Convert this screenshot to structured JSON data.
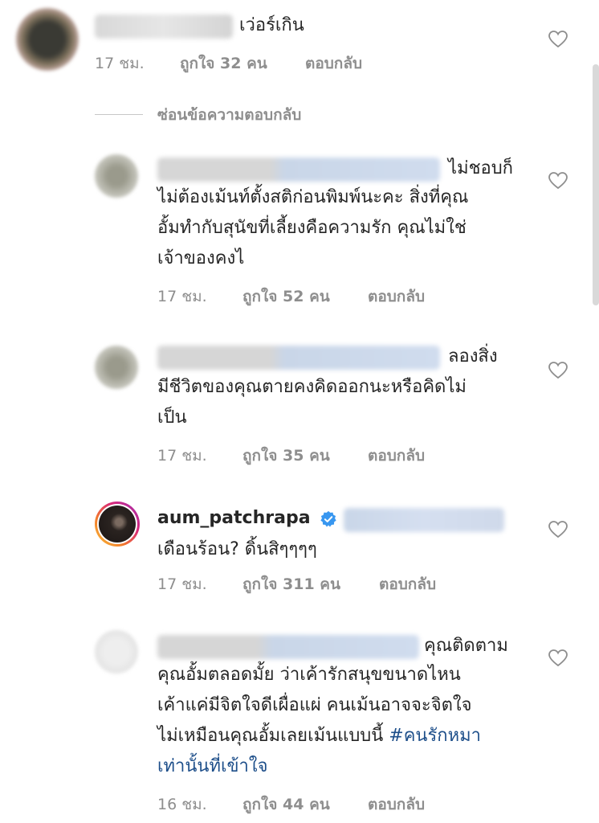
{
  "comments": [
    {
      "text": "เว่อร์เกิน",
      "time": "17 ชม.",
      "likes": "ถูกใจ 32 คน",
      "reply": "ตอบกลับ"
    },
    {
      "text_lines": [
        "ไม่ชอบก็",
        "ไม่ต้องเม้นท์ตั้งสติก่อนพิมพ์นะคะ สิ่งที่คุณ",
        "อั้มทำกับสุนัขที่เลี้ยงคือความรัก คุณไม่ใช่",
        "เจ้าของคงไ"
      ],
      "time": "17 ชม.",
      "likes": "ถูกใจ 52 คน",
      "reply": "ตอบกลับ"
    },
    {
      "text_lines": [
        "ลองสิ่ง",
        "มีชีวิตของคุณตายคงคิดออกนะหรือคิดไม่",
        "เป็น"
      ],
      "time": "17 ชม.",
      "likes": "ถูกใจ 35 คน",
      "reply": "ตอบกลับ"
    },
    {
      "username": "aum_patchrapa",
      "text": "เดือนร้อน? ดิ้นสิๆๆๆๆ",
      "time": "17 ชม.",
      "likes": "ถูกใจ 311 คน",
      "reply": "ตอบกลับ"
    },
    {
      "text_lines": [
        "คุณติดตาม",
        "คุณอั้มตลอดมั้ย ว่าเค้ารักสนุขขนาดไหน",
        "เค้าแค่มีจิตใจดีเผื่อแผ่ คนเม้นอาจจะจิตใจ",
        "ไม่เหมือนคุณอั้มเลยเม้นแบบนี้ "
      ],
      "hashtag": "#คนรักหมา",
      "text_last": "เท่านั้นที่เข้าใจ",
      "time": "16 ชม.",
      "likes": "ถูกใจ 44 คน",
      "reply": "ตอบกลับ"
    }
  ],
  "hide_replies": "ซ่อนข้อความตอบกลับ",
  "icons": {
    "like": "heart-outline-icon",
    "verified": "verified-badge-icon"
  },
  "colors": {
    "text": "#262626",
    "meta": "#8e8e8e",
    "hashtag": "#1e4f8a",
    "verified": "#3897f0"
  }
}
